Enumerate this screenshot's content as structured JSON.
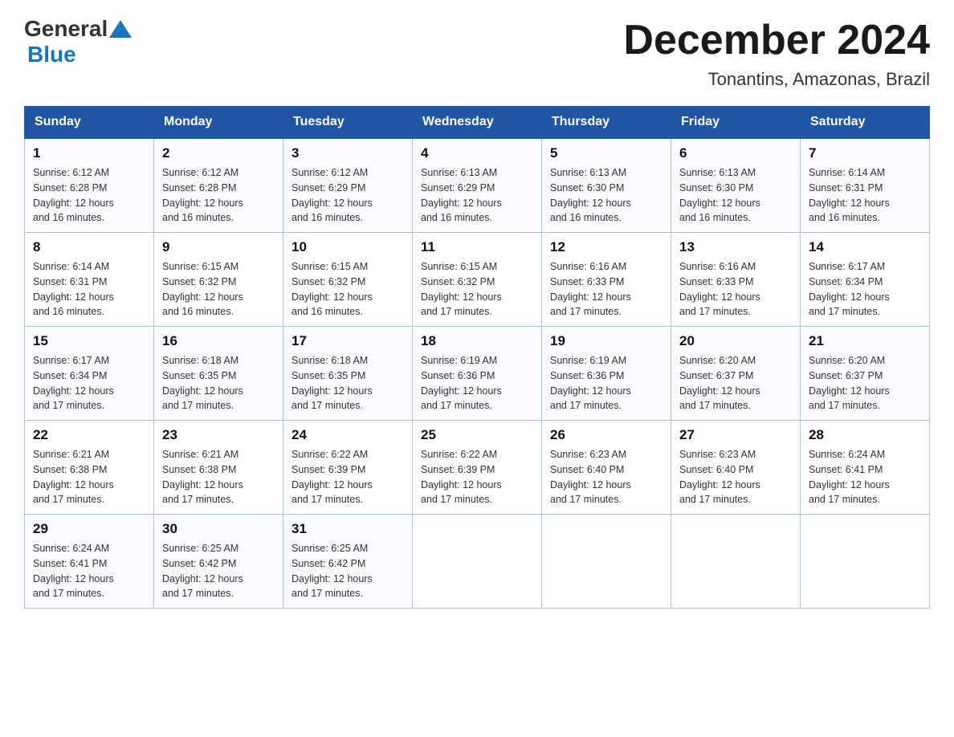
{
  "logo": {
    "general": "General",
    "blue": "Blue"
  },
  "title": "December 2024",
  "subtitle": "Tonantins, Amazonas, Brazil",
  "weekdays": [
    "Sunday",
    "Monday",
    "Tuesday",
    "Wednesday",
    "Thursday",
    "Friday",
    "Saturday"
  ],
  "weeks": [
    [
      {
        "day": "1",
        "sunrise": "6:12 AM",
        "sunset": "6:28 PM",
        "daylight": "12 hours and 16 minutes."
      },
      {
        "day": "2",
        "sunrise": "6:12 AM",
        "sunset": "6:28 PM",
        "daylight": "12 hours and 16 minutes."
      },
      {
        "day": "3",
        "sunrise": "6:12 AM",
        "sunset": "6:29 PM",
        "daylight": "12 hours and 16 minutes."
      },
      {
        "day": "4",
        "sunrise": "6:13 AM",
        "sunset": "6:29 PM",
        "daylight": "12 hours and 16 minutes."
      },
      {
        "day": "5",
        "sunrise": "6:13 AM",
        "sunset": "6:30 PM",
        "daylight": "12 hours and 16 minutes."
      },
      {
        "day": "6",
        "sunrise": "6:13 AM",
        "sunset": "6:30 PM",
        "daylight": "12 hours and 16 minutes."
      },
      {
        "day": "7",
        "sunrise": "6:14 AM",
        "sunset": "6:31 PM",
        "daylight": "12 hours and 16 minutes."
      }
    ],
    [
      {
        "day": "8",
        "sunrise": "6:14 AM",
        "sunset": "6:31 PM",
        "daylight": "12 hours and 16 minutes."
      },
      {
        "day": "9",
        "sunrise": "6:15 AM",
        "sunset": "6:32 PM",
        "daylight": "12 hours and 16 minutes."
      },
      {
        "day": "10",
        "sunrise": "6:15 AM",
        "sunset": "6:32 PM",
        "daylight": "12 hours and 16 minutes."
      },
      {
        "day": "11",
        "sunrise": "6:15 AM",
        "sunset": "6:32 PM",
        "daylight": "12 hours and 17 minutes."
      },
      {
        "day": "12",
        "sunrise": "6:16 AM",
        "sunset": "6:33 PM",
        "daylight": "12 hours and 17 minutes."
      },
      {
        "day": "13",
        "sunrise": "6:16 AM",
        "sunset": "6:33 PM",
        "daylight": "12 hours and 17 minutes."
      },
      {
        "day": "14",
        "sunrise": "6:17 AM",
        "sunset": "6:34 PM",
        "daylight": "12 hours and 17 minutes."
      }
    ],
    [
      {
        "day": "15",
        "sunrise": "6:17 AM",
        "sunset": "6:34 PM",
        "daylight": "12 hours and 17 minutes."
      },
      {
        "day": "16",
        "sunrise": "6:18 AM",
        "sunset": "6:35 PM",
        "daylight": "12 hours and 17 minutes."
      },
      {
        "day": "17",
        "sunrise": "6:18 AM",
        "sunset": "6:35 PM",
        "daylight": "12 hours and 17 minutes."
      },
      {
        "day": "18",
        "sunrise": "6:19 AM",
        "sunset": "6:36 PM",
        "daylight": "12 hours and 17 minutes."
      },
      {
        "day": "19",
        "sunrise": "6:19 AM",
        "sunset": "6:36 PM",
        "daylight": "12 hours and 17 minutes."
      },
      {
        "day": "20",
        "sunrise": "6:20 AM",
        "sunset": "6:37 PM",
        "daylight": "12 hours and 17 minutes."
      },
      {
        "day": "21",
        "sunrise": "6:20 AM",
        "sunset": "6:37 PM",
        "daylight": "12 hours and 17 minutes."
      }
    ],
    [
      {
        "day": "22",
        "sunrise": "6:21 AM",
        "sunset": "6:38 PM",
        "daylight": "12 hours and 17 minutes."
      },
      {
        "day": "23",
        "sunrise": "6:21 AM",
        "sunset": "6:38 PM",
        "daylight": "12 hours and 17 minutes."
      },
      {
        "day": "24",
        "sunrise": "6:22 AM",
        "sunset": "6:39 PM",
        "daylight": "12 hours and 17 minutes."
      },
      {
        "day": "25",
        "sunrise": "6:22 AM",
        "sunset": "6:39 PM",
        "daylight": "12 hours and 17 minutes."
      },
      {
        "day": "26",
        "sunrise": "6:23 AM",
        "sunset": "6:40 PM",
        "daylight": "12 hours and 17 minutes."
      },
      {
        "day": "27",
        "sunrise": "6:23 AM",
        "sunset": "6:40 PM",
        "daylight": "12 hours and 17 minutes."
      },
      {
        "day": "28",
        "sunrise": "6:24 AM",
        "sunset": "6:41 PM",
        "daylight": "12 hours and 17 minutes."
      }
    ],
    [
      {
        "day": "29",
        "sunrise": "6:24 AM",
        "sunset": "6:41 PM",
        "daylight": "12 hours and 17 minutes."
      },
      {
        "day": "30",
        "sunrise": "6:25 AM",
        "sunset": "6:42 PM",
        "daylight": "12 hours and 17 minutes."
      },
      {
        "day": "31",
        "sunrise": "6:25 AM",
        "sunset": "6:42 PM",
        "daylight": "12 hours and 17 minutes."
      },
      null,
      null,
      null,
      null
    ]
  ],
  "labels": {
    "sunrise": "Sunrise:",
    "sunset": "Sunset:",
    "daylight": "Daylight:"
  },
  "colors": {
    "header_bg": "#2255a4",
    "header_text": "#ffffff",
    "border": "#aac4e0",
    "accent": "#1a75bb"
  }
}
